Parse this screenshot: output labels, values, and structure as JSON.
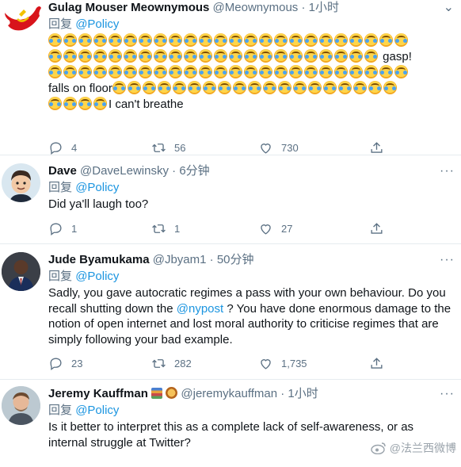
{
  "tweets": [
    {
      "name": "Gulag Mouser Meownymous",
      "handle": "@Meownymous",
      "time": "1小时",
      "reply_prefix": "回复",
      "reply_to": "@Policy",
      "text_gasp": "gasp!",
      "text_falls": "falls on floor",
      "text_breathe": "I can't breathe",
      "replies": "4",
      "retweets": "56",
      "likes": "730"
    },
    {
      "name": "Dave",
      "handle": "@DaveLewinsky",
      "time": "6分钟",
      "reply_prefix": "回复",
      "reply_to": "@Policy",
      "text": "Did ya'll laugh too?",
      "replies": "1",
      "retweets": "1",
      "likes": "27"
    },
    {
      "name": "Jude Byamukama",
      "handle": "@Jbyam1",
      "time": "50分钟",
      "reply_prefix": "回复",
      "reply_to": "@Policy",
      "text_pre": "Sadly, you gave autocratic regimes a pass with your own behaviour. Do you recall shutting down the ",
      "text_mention": "@nypost",
      "text_post": " ?  You have done enormous damage to the notion of open internet and lost moral authority to criticise regimes that are simply following your bad example.",
      "replies": "23",
      "retweets": "282",
      "likes": "1,735"
    },
    {
      "name": "Jeremy Kauffman",
      "handle": "@jeremykauffman",
      "time": "1小时",
      "reply_prefix": "回复",
      "reply_to": "@Policy",
      "text": "Is it better to interpret this as a complete lack of self-awareness, or as internal struggle at Twitter?"
    }
  ],
  "watermark": "@法兰西微博",
  "icons": [
    "reply-icon",
    "retweet-icon",
    "like-icon",
    "share-icon",
    "more-icon",
    "weibo-icon",
    "laughing-emoji-icon"
  ]
}
